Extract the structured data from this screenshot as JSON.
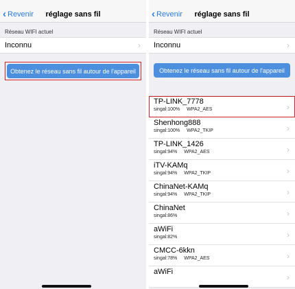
{
  "nav": {
    "back_label": "Revenir",
    "title": "réglage sans fil"
  },
  "current": {
    "section_label": "Réseau WIFI actuel",
    "value": "Inconnu"
  },
  "scan_button": "Obtenez le réseau sans fil autour de l'appareil",
  "networks": [
    {
      "name": "TP-LINK_7778",
      "signal": "singal:100%",
      "security": "WPA2_AES"
    },
    {
      "name": "Shenhong888",
      "signal": "singal:100%",
      "security": "WPA2_TKIP"
    },
    {
      "name": "TP-LINK_1426",
      "signal": "singal:94%",
      "security": "WPA2_AES"
    },
    {
      "name": "iTV-KAMq",
      "signal": "singal:94%",
      "security": "WPA2_TKIP"
    },
    {
      "name": "ChinaNet-KAMq",
      "signal": "singal:94%",
      "security": "WPA2_TKIP"
    },
    {
      "name": "ChinaNet",
      "signal": "singal:86%",
      "security": ""
    },
    {
      "name": "aWiFi",
      "signal": "singal:82%",
      "security": ""
    },
    {
      "name": "CMCC-6kkn",
      "signal": "singal:78%",
      "security": "WPA2_AES"
    },
    {
      "name": "aWiFi",
      "signal": "",
      "security": ""
    }
  ],
  "icons": {
    "back": "chevron-left-icon",
    "disclosure": "chevron-right-icon"
  },
  "colors": {
    "accent": "#2c7be5",
    "button": "#4c8fde",
    "highlight": "#d0222a"
  }
}
